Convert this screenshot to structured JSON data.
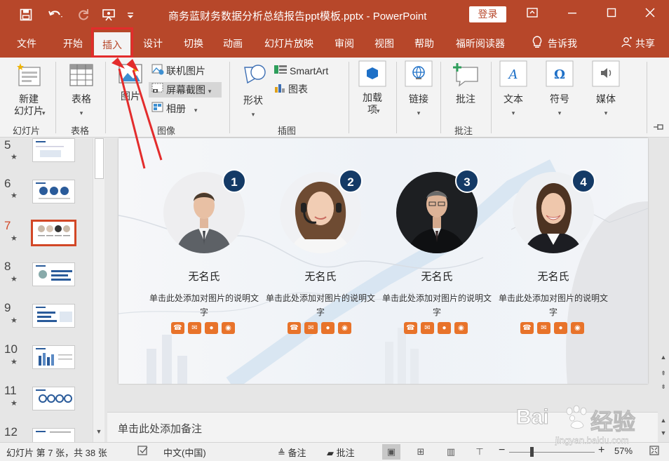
{
  "titlebar": {
    "doc_title": "商务蓝财务数据分析总结报告ppt模板.pptx  -  PowerPoint",
    "login": "登录",
    "bg_color": "#b7472a"
  },
  "tabs": [
    {
      "label": "文件"
    },
    {
      "label": "开始"
    },
    {
      "label": "插入"
    },
    {
      "label": "设计"
    },
    {
      "label": "切换"
    },
    {
      "label": "动画"
    },
    {
      "label": "幻灯片放映"
    },
    {
      "label": "审阅"
    },
    {
      "label": "视图"
    },
    {
      "label": "帮助"
    },
    {
      "label": "福昕阅读器"
    },
    {
      "label": "告诉我"
    },
    {
      "label": "共享"
    }
  ],
  "ribbon": {
    "new_slide": "新建\n幻灯片",
    "table": "表格",
    "picture": "图片",
    "online_picture": "联机图片",
    "screenshot": "屏幕截图",
    "album": "相册",
    "shapes": "形状",
    "smartart": "SmartArt",
    "chart": "图表",
    "addins": "加载\n项",
    "link": "链接",
    "comment": "批注",
    "text": "文本",
    "symbol": "符号",
    "media": "媒体",
    "groups": {
      "slides": "幻灯片",
      "tables": "表格",
      "images": "图像",
      "illustrations": "插图",
      "comments": "批注"
    }
  },
  "thumbnails": [
    {
      "number": "5",
      "star": "★"
    },
    {
      "number": "6",
      "star": "★"
    },
    {
      "number": "7",
      "star": "★",
      "selected": true
    },
    {
      "number": "8",
      "star": "★"
    },
    {
      "number": "9",
      "star": "★"
    },
    {
      "number": "10",
      "star": "★"
    },
    {
      "number": "11",
      "star": "★"
    },
    {
      "number": "12",
      "star": ""
    }
  ],
  "slide": {
    "people": [
      {
        "badge": "1",
        "name": "无名氏",
        "desc": "单击此处添加对图片的说明文字"
      },
      {
        "badge": "2",
        "name": "无名氏",
        "desc": "单击此处添加对图片的说明文字"
      },
      {
        "badge": "3",
        "name": "无名氏",
        "desc": "单击此处添加对图片的说明文字"
      },
      {
        "badge": "4",
        "name": "无名氏",
        "desc": "单击此处添加对图片的说明文字"
      }
    ],
    "accent_color": "#e8732a",
    "badge_color": "#143a66"
  },
  "notes": {
    "placeholder": "单击此处添加备注"
  },
  "statusbar": {
    "slide_info": "幻灯片 第 7 张，共 38 张",
    "language": "中文(中国)",
    "notes": "备注",
    "comments": "批注",
    "zoom_pct": "57%",
    "zoom_level": 57
  },
  "watermark": {
    "brand": "Bai",
    "brand_cn": "经验",
    "url": "jingyan.baidu.com"
  }
}
